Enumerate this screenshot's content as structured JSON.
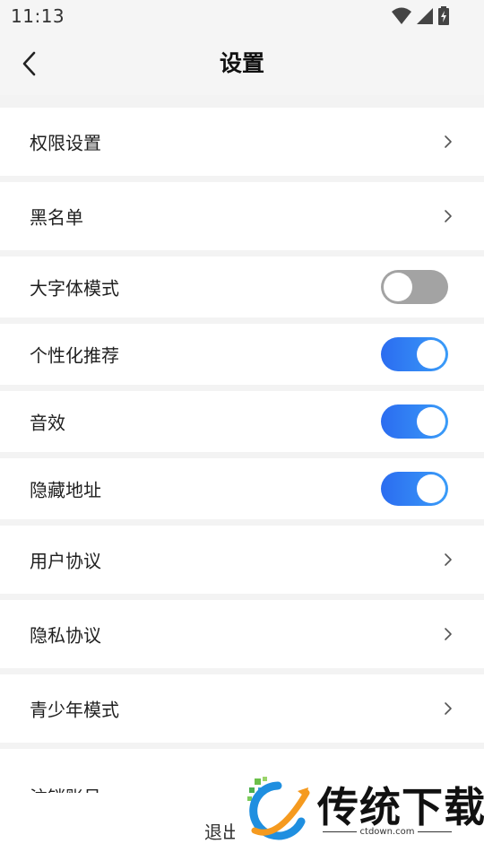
{
  "status_bar": {
    "time": "11:13",
    "icons": [
      "wifi-icon",
      "signal-icon",
      "battery-charging-icon"
    ]
  },
  "header": {
    "title": "设置",
    "back_icon": "chevron-left-icon"
  },
  "settings": {
    "permissions": {
      "label": "权限设置"
    },
    "blacklist": {
      "label": "黑名单"
    },
    "large_font": {
      "label": "大字体模式",
      "enabled": false
    },
    "personalized": {
      "label": "个性化推荐",
      "enabled": true
    },
    "sound": {
      "label": "音效",
      "enabled": true
    },
    "hide_address": {
      "label": "隐藏地址",
      "enabled": true
    },
    "user_agreement": {
      "label": "用户协议"
    },
    "privacy": {
      "label": "隐私协议"
    },
    "teen_mode": {
      "label": "青少年模式"
    },
    "cancel_account": {
      "label": "注销账号"
    }
  },
  "logout": {
    "label": "退出登录"
  },
  "watermark": {
    "brand": "传统下载",
    "url": "ctdown.com"
  },
  "colors": {
    "toggle_on_start": "#2b6cf0",
    "toggle_on_end": "#3a9cf8",
    "toggle_off": "#a3a3a3",
    "background": "#f3f3f3"
  }
}
